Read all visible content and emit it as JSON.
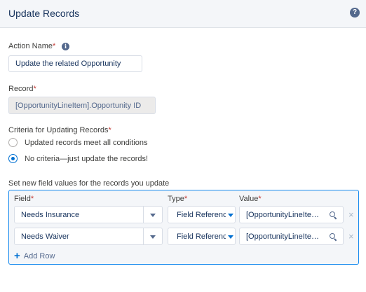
{
  "header": {
    "title": "Update Records",
    "help_icon": "question-circle-icon",
    "help_glyph": "?"
  },
  "action_name": {
    "label": "Action Name",
    "required": "*",
    "info_glyph": "i",
    "value": "Update the related Opportunity"
  },
  "record": {
    "label": "Record",
    "required": "*",
    "value": "[OpportunityLineItem].Opportunity ID"
  },
  "criteria": {
    "label": "Criteria for Updating Records",
    "required": "*",
    "options": [
      {
        "label": "Updated records meet all conditions",
        "checked": false
      },
      {
        "label": "No criteria—just update the records!",
        "checked": true
      }
    ]
  },
  "field_values": {
    "section_label": "Set new field values for the records you update",
    "columns": {
      "field": "Field",
      "type": "Type",
      "value": "Value",
      "required": "*"
    },
    "rows": [
      {
        "field": "Needs Insurance",
        "type": "Field Reference",
        "value": "[OpportunityLineItem].Needs Insurance"
      },
      {
        "field": "Needs Waiver",
        "type": "Field Reference",
        "value": "[OpportunityLineItem].Needs Waiver"
      }
    ],
    "remove_glyph": "×",
    "add_row_glyph": "+",
    "add_row_label": "Add Row"
  },
  "colors": {
    "accent": "#0070d2",
    "focus_border": "#1589ee",
    "required": "#c23934",
    "text": "#16325c"
  }
}
